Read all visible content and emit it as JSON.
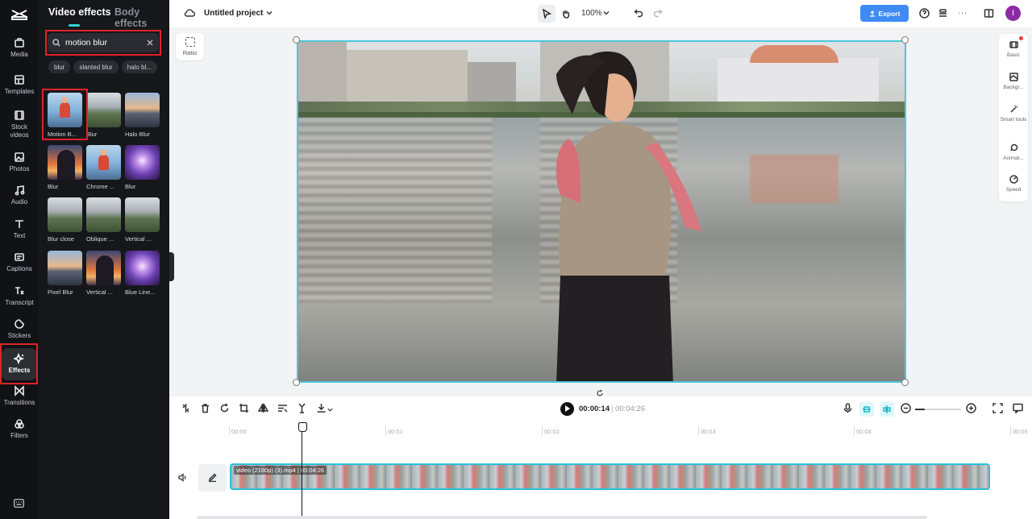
{
  "rail": {
    "items": [
      {
        "label": "Media",
        "icon": "media-icon"
      },
      {
        "label": "Templates",
        "icon": "templates-icon"
      },
      {
        "label": "Stock videos",
        "icon": "stock-videos-icon"
      },
      {
        "label": "Photos",
        "icon": "photos-icon"
      },
      {
        "label": "Audio",
        "icon": "audio-icon"
      },
      {
        "label": "Text",
        "icon": "text-icon"
      },
      {
        "label": "Captions",
        "icon": "captions-icon"
      },
      {
        "label": "Transcript",
        "icon": "transcript-icon"
      },
      {
        "label": "Stickers",
        "icon": "stickers-icon"
      },
      {
        "label": "Effects",
        "icon": "effects-icon"
      },
      {
        "label": "Transitions",
        "icon": "transitions-icon"
      },
      {
        "label": "Filters",
        "icon": "filters-icon"
      }
    ],
    "active": "Effects"
  },
  "panel": {
    "tabs": [
      "Video effects",
      "Body effects"
    ],
    "search": {
      "value": "motion blur"
    },
    "chips": [
      "blur",
      "slanted blur",
      "halo bl..."
    ],
    "effects": [
      "Motion B...",
      "Blur",
      "Halo Blur",
      "Blur",
      "Chrome ...",
      "Blur",
      "Blur close",
      "Oblique ...",
      "Vertical ...",
      "Pixel Blur",
      "Vertical ...",
      "Blue Line..."
    ]
  },
  "topbar": {
    "project_title": "Untitled project",
    "zoom": "100%",
    "export_label": "Export",
    "avatar_initial": "I"
  },
  "canvas": {
    "ratio_label": "Ratio"
  },
  "right_rail": [
    "Basic",
    "Backgr...",
    "Smart tools",
    "Animat...",
    "Speed"
  ],
  "timeline": {
    "current_time": "00:00:14",
    "separator": "|",
    "total_time": "00:04:26",
    "ruler": [
      "00:00",
      "00:01",
      "00:02",
      "00:03",
      "00:04",
      "00:05"
    ],
    "clip_label": "video (2160p) (3).mp4 | 00:04:26"
  },
  "colors": {
    "accent": "#3f8bf4",
    "selection": "#4cc7d8",
    "highlight": "#e0222a"
  }
}
